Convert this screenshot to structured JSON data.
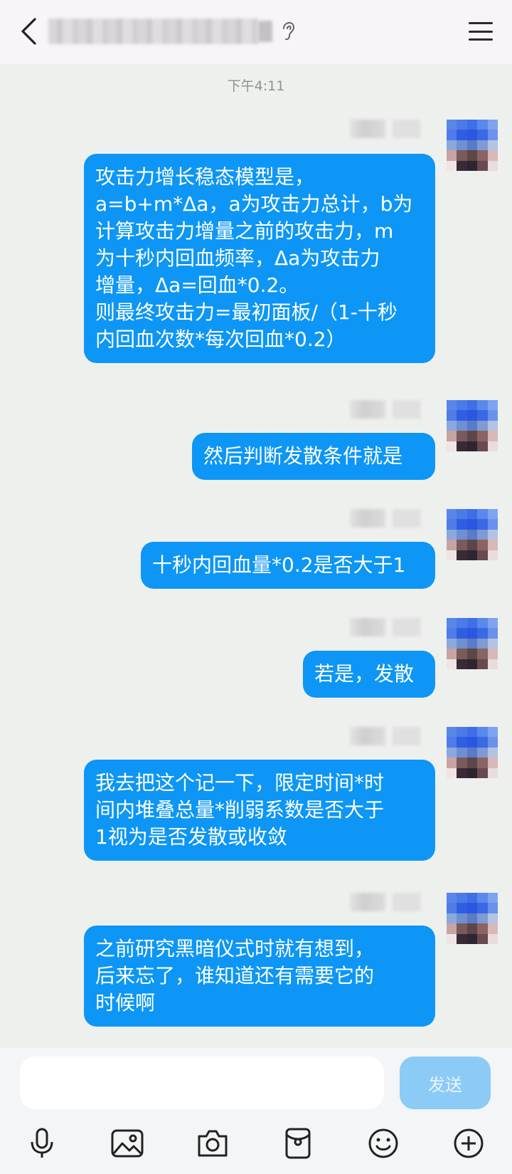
{
  "header": {
    "back_icon": "chevron-left-icon",
    "title_obscured": true,
    "ear_icon": "ear-icon",
    "menu_icon": "menu-icon"
  },
  "time_separator": "下午4:11",
  "colors": {
    "bubble": "#0d96f5",
    "bubble_text": "#ffffff",
    "background": "#eef0ee",
    "send_button": "#8ccbf6"
  },
  "messages": [
    {
      "text": "攻击力增长稳态模型是，\na=b+m*Δa，a为攻击力总计，b为\n计算攻击力增量之前的攻击力，m\n为十秒内回血频率，Δa为攻击力\n增量，Δa=回血*0.2。\n则最终攻击力=最初面板/（1-十秒\n内回血次数*每次回血*0.2）"
    },
    {
      "text": "然后判断发散条件就是"
    },
    {
      "text": "十秒内回血量*0.2是否大于1"
    },
    {
      "text": "若是，发散"
    },
    {
      "text": "我去把这个记一下，限定时间*时\n间内堆叠总量*削弱系数是否大于\n1视为是否发散或收敛"
    },
    {
      "text": "之前研究黑暗仪式时就有想到，\n后来忘了，谁知道还有需要它的\n时候啊"
    }
  ],
  "input": {
    "value": "",
    "placeholder": "",
    "send_label": "发送"
  },
  "toolbar": [
    {
      "icon": "microphone-icon"
    },
    {
      "icon": "image-icon"
    },
    {
      "icon": "camera-icon"
    },
    {
      "icon": "red-packet-icon"
    },
    {
      "icon": "emoji-icon"
    },
    {
      "icon": "plus-icon"
    }
  ]
}
